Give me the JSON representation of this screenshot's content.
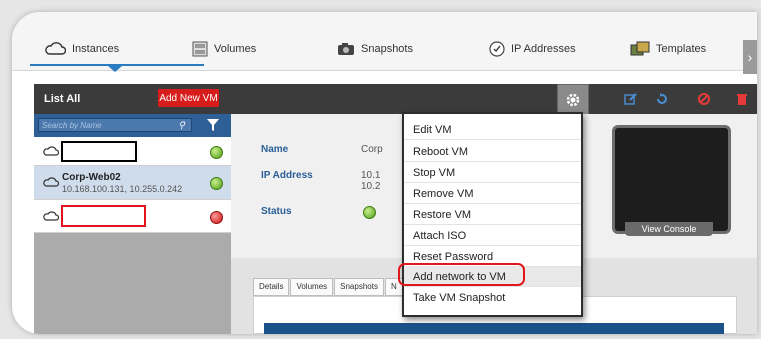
{
  "tabs": [
    {
      "label": "Instances",
      "icon": "cloud-icon"
    },
    {
      "label": "Volumes",
      "icon": "volume-icon"
    },
    {
      "label": "Snapshots",
      "icon": "camera-icon"
    },
    {
      "label": "IP Addresses",
      "icon": "ip-address-icon"
    },
    {
      "label": "Templates",
      "icon": "templates-icon"
    }
  ],
  "toolbar": {
    "list_all": "List All",
    "add_new": "Add New VM"
  },
  "search": {
    "placeholder": "Search by Name"
  },
  "vms": [
    {
      "name": "",
      "ip": "",
      "status": "running"
    },
    {
      "name": "Corp-Web02",
      "ip": "10.168.100.131, 10.255.0.242",
      "status": "running"
    },
    {
      "name": "",
      "ip": "",
      "status": "stopped"
    }
  ],
  "details": {
    "name_label": "Name",
    "name_value": "Corp",
    "ip_label": "IP Address",
    "ip_value_1": "10.1",
    "ip_value_2": "10.2",
    "status_label": "Status"
  },
  "console": {
    "button": "View Console"
  },
  "inner_tabs": [
    "Details",
    "Volumes",
    "Snapshots",
    "N"
  ],
  "menu": [
    "Edit VM",
    "Reboot VM",
    "Stop VM",
    "Remove VM",
    "Restore VM",
    "Attach ISO",
    "Reset Password",
    "Add network to VM",
    "Take VM Snapshot"
  ],
  "colors": {
    "accent": "#2a7bbf",
    "danger": "#d71c1c",
    "toolbar": "#3b3b3b",
    "highlight": "#e0161c"
  }
}
